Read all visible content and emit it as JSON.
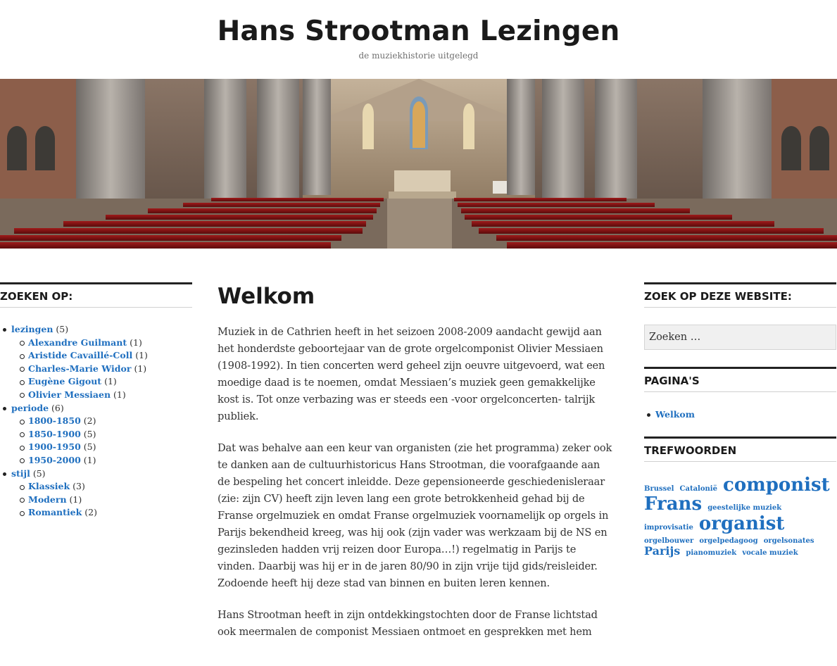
{
  "site": {
    "title": "Hans Strootman Lezingen",
    "description": "de muziekhistorie uitgelegd"
  },
  "left_sidebar": {
    "title": "ZOEKEN OP:",
    "categories": [
      {
        "label": "lezingen",
        "count": "(5)",
        "children": [
          {
            "label": "Alexandre Guilmant",
            "count": "(1)"
          },
          {
            "label": "Aristide Cavaillé-Coll",
            "count": "(1)"
          },
          {
            "label": "Charles-Marie Widor",
            "count": "(1)"
          },
          {
            "label": "Eugène Gigout",
            "count": "(1)"
          },
          {
            "label": "Olivier Messiaen",
            "count": "(1)"
          }
        ]
      },
      {
        "label": "periode",
        "count": "(6)",
        "children": [
          {
            "label": "1800-1850",
            "count": "(2)"
          },
          {
            "label": "1850-1900",
            "count": "(5)"
          },
          {
            "label": "1900-1950",
            "count": "(5)"
          },
          {
            "label": "1950-2000",
            "count": "(1)"
          }
        ]
      },
      {
        "label": "stijl",
        "count": "(5)",
        "children": [
          {
            "label": "Klassiek",
            "count": "(3)"
          },
          {
            "label": "Modern",
            "count": "(1)"
          },
          {
            "label": "Romantiek",
            "count": "(2)"
          }
        ]
      }
    ]
  },
  "main": {
    "title": "Welkom",
    "paragraphs": [
      "Muziek in de Cathrien heeft in het seizoen 2008-2009 aandacht gewijd aan het honderdste geboortejaar van de grote orgelcomponist Olivier Messiaen (1908-1992). In tien concerten werd geheel zijn oeuvre uitgevoerd, wat een moedige daad is te noemen, omdat Messiaen’s muziek geen gemakkelijke kost is. Tot onze verbazing was er steeds een -voor orgelconcerten- talrijk publiek.",
      "Dat was behalve aan een keur van organisten (zie het programma) zeker ook te danken aan de cultuurhistoricus Hans Strootman, die voorafgaande aan de bespeling het concert inleidde. Deze gepensioneerde geschiedenisleraar (zie: zijn CV) heeft zijn leven lang een grote betrokkenheid gehad bij de Franse orgelmuziek en omdat Franse orgelmuziek voornamelijk op orgels in Parijs bekendheid kreeg, was hij ook (zijn vader was werkzaam bij de NS en gezinsleden hadden vrij reizen door Europa…!) regelmatig in Parijs te vinden. Daarbij was hij er in de jaren 80/90  in zijn vrije tijd gids/reisleider. Zodoende heeft  hij deze stad van binnen en buiten leren kennen.",
      "Hans Strootman heeft in zijn ontdekkingstochten door de Franse lichtstad ook meermalen de componist Messiaen ontmoet en gesprekken met hem"
    ]
  },
  "right_sidebar": {
    "search_title": "ZOEK OP DEZE WEBSITE:",
    "search_placeholder": "Zoeken …",
    "pages_title": "PAGINA'S",
    "pages": [
      "Welkom"
    ],
    "tags_title": "TREFWOORDEN",
    "tags": [
      {
        "label": "Brussel",
        "size": "sm"
      },
      {
        "label": "Catalonië",
        "size": "sm"
      },
      {
        "label": "componist",
        "size": "lg"
      },
      {
        "label": "Frans",
        "size": "lg"
      },
      {
        "label": "geestelijke muziek",
        "size": "sm"
      },
      {
        "label": "improvisatie",
        "size": "sm"
      },
      {
        "label": "organist",
        "size": "lg"
      },
      {
        "label": "orgelbouwer",
        "size": "sm"
      },
      {
        "label": "orgelpedagoog",
        "size": "sm"
      },
      {
        "label": "orgelsonates",
        "size": "sm"
      },
      {
        "label": "Parijs",
        "size": "md"
      },
      {
        "label": "pianomuziek",
        "size": "sm"
      },
      {
        "label": "vocale muziek",
        "size": "sm"
      }
    ]
  },
  "colors": {
    "link": "#1f6fbf",
    "heading": "#1a1a1a",
    "text": "#333333"
  }
}
